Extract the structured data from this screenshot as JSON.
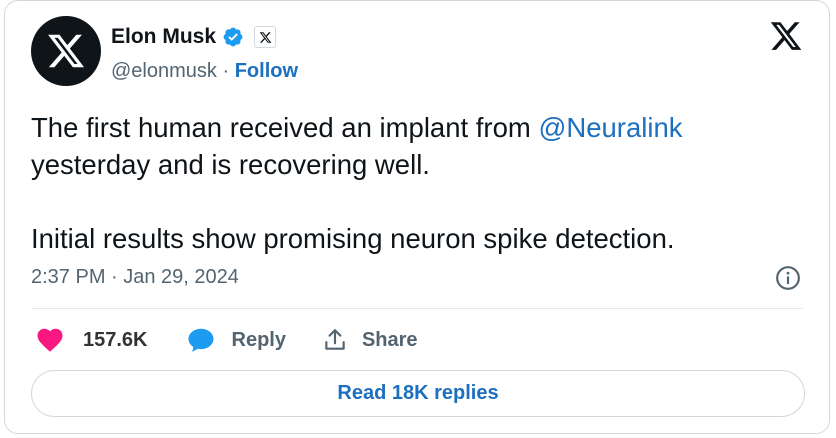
{
  "author": {
    "name": "Elon Musk",
    "handle": "@elonmusk",
    "separator": "·",
    "follow_label": "Follow",
    "avatar_icon": "x-logo-icon",
    "verified_icon": "verified-badge-icon",
    "affiliation_icon": "x-affiliation-badge-icon"
  },
  "tweet": {
    "line1_prefix": "The first human received an implant from ",
    "mention": "@Neuralink",
    "line1_suffix": " yesterday and is recovering well.",
    "line2": "Initial results show promising neuron spike detection.",
    "timestamp": "2:37 PM · Jan 29, 2024"
  },
  "actions": {
    "like_count": "157.6K",
    "reply_label": "Reply",
    "share_label": "Share"
  },
  "read_replies_label": "Read 18K replies",
  "colors": {
    "accent": "#1d6fbf",
    "verified": "#1d9bf0",
    "like": "#f91880",
    "text": "#0f1419",
    "muted": "#536471"
  }
}
